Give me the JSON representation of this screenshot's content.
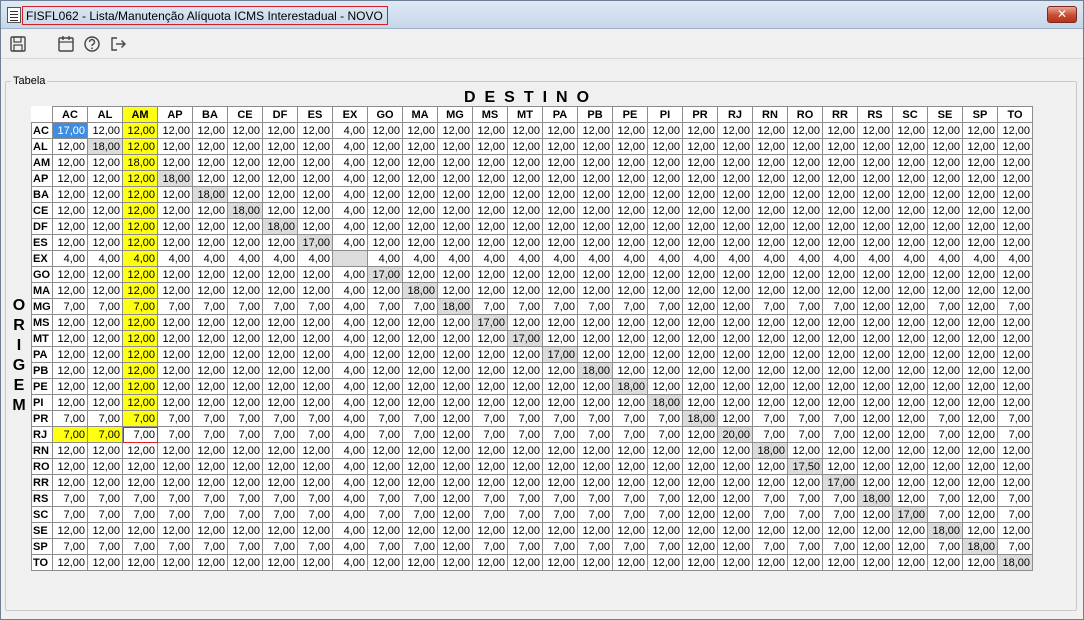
{
  "window": {
    "title": "FISFL062 - Lista/Manutenção Alíquota ICMS Interestadual - NOVO",
    "close_label": "✕"
  },
  "toolbar": {
    "icons": [
      "save-icon",
      "calendar-icon",
      "help-icon",
      "exit-icon"
    ]
  },
  "group": {
    "title": "Tabela"
  },
  "axis": {
    "destino": "DESTINO",
    "origem": [
      "O",
      "R",
      "I",
      "G",
      "E",
      "M"
    ]
  },
  "states": [
    "AC",
    "AL",
    "AM",
    "AP",
    "BA",
    "CE",
    "DF",
    "ES",
    "EX",
    "GO",
    "MA",
    "MG",
    "MS",
    "MT",
    "PA",
    "PB",
    "PE",
    "PI",
    "PR",
    "RJ",
    "RN",
    "RO",
    "RR",
    "RS",
    "SC",
    "SE",
    "SP",
    "TO"
  ],
  "rows": [
    {
      "uf": "AC",
      "v": [
        "17,00",
        "12,00",
        "12,00",
        "12,00",
        "12,00",
        "12,00",
        "12,00",
        "12,00",
        "4,00",
        "12,00",
        "12,00",
        "12,00",
        "12,00",
        "12,00",
        "12,00",
        "12,00",
        "12,00",
        "12,00",
        "12,00",
        "12,00",
        "12,00",
        "12,00",
        "12,00",
        "12,00",
        "12,00",
        "12,00",
        "12,00",
        "12,00"
      ]
    },
    {
      "uf": "AL",
      "v": [
        "12,00",
        "18,00",
        "12,00",
        "12,00",
        "12,00",
        "12,00",
        "12,00",
        "12,00",
        "4,00",
        "12,00",
        "12,00",
        "12,00",
        "12,00",
        "12,00",
        "12,00",
        "12,00",
        "12,00",
        "12,00",
        "12,00",
        "12,00",
        "12,00",
        "12,00",
        "12,00",
        "12,00",
        "12,00",
        "12,00",
        "12,00",
        "12,00"
      ]
    },
    {
      "uf": "AM",
      "v": [
        "12,00",
        "12,00",
        "18,00",
        "12,00",
        "12,00",
        "12,00",
        "12,00",
        "12,00",
        "4,00",
        "12,00",
        "12,00",
        "12,00",
        "12,00",
        "12,00",
        "12,00",
        "12,00",
        "12,00",
        "12,00",
        "12,00",
        "12,00",
        "12,00",
        "12,00",
        "12,00",
        "12,00",
        "12,00",
        "12,00",
        "12,00",
        "12,00"
      ]
    },
    {
      "uf": "AP",
      "v": [
        "12,00",
        "12,00",
        "12,00",
        "18,00",
        "12,00",
        "12,00",
        "12,00",
        "12,00",
        "4,00",
        "12,00",
        "12,00",
        "12,00",
        "12,00",
        "12,00",
        "12,00",
        "12,00",
        "12,00",
        "12,00",
        "12,00",
        "12,00",
        "12,00",
        "12,00",
        "12,00",
        "12,00",
        "12,00",
        "12,00",
        "12,00",
        "12,00"
      ]
    },
    {
      "uf": "BA",
      "v": [
        "12,00",
        "12,00",
        "12,00",
        "12,00",
        "18,00",
        "12,00",
        "12,00",
        "12,00",
        "4,00",
        "12,00",
        "12,00",
        "12,00",
        "12,00",
        "12,00",
        "12,00",
        "12,00",
        "12,00",
        "12,00",
        "12,00",
        "12,00",
        "12,00",
        "12,00",
        "12,00",
        "12,00",
        "12,00",
        "12,00",
        "12,00",
        "12,00"
      ]
    },
    {
      "uf": "CE",
      "v": [
        "12,00",
        "12,00",
        "12,00",
        "12,00",
        "12,00",
        "18,00",
        "12,00",
        "12,00",
        "4,00",
        "12,00",
        "12,00",
        "12,00",
        "12,00",
        "12,00",
        "12,00",
        "12,00",
        "12,00",
        "12,00",
        "12,00",
        "12,00",
        "12,00",
        "12,00",
        "12,00",
        "12,00",
        "12,00",
        "12,00",
        "12,00",
        "12,00"
      ]
    },
    {
      "uf": "DF",
      "v": [
        "12,00",
        "12,00",
        "12,00",
        "12,00",
        "12,00",
        "12,00",
        "18,00",
        "12,00",
        "4,00",
        "12,00",
        "12,00",
        "12,00",
        "12,00",
        "12,00",
        "12,00",
        "12,00",
        "12,00",
        "12,00",
        "12,00",
        "12,00",
        "12,00",
        "12,00",
        "12,00",
        "12,00",
        "12,00",
        "12,00",
        "12,00",
        "12,00"
      ]
    },
    {
      "uf": "ES",
      "v": [
        "12,00",
        "12,00",
        "12,00",
        "12,00",
        "12,00",
        "12,00",
        "12,00",
        "17,00",
        "4,00",
        "12,00",
        "12,00",
        "12,00",
        "12,00",
        "12,00",
        "12,00",
        "12,00",
        "12,00",
        "12,00",
        "12,00",
        "12,00",
        "12,00",
        "12,00",
        "12,00",
        "12,00",
        "12,00",
        "12,00",
        "12,00",
        "12,00"
      ]
    },
    {
      "uf": "EX",
      "v": [
        "4,00",
        "4,00",
        "4,00",
        "4,00",
        "4,00",
        "4,00",
        "4,00",
        "4,00",
        "",
        "4,00",
        "4,00",
        "4,00",
        "4,00",
        "4,00",
        "4,00",
        "4,00",
        "4,00",
        "4,00",
        "4,00",
        "4,00",
        "4,00",
        "4,00",
        "4,00",
        "4,00",
        "4,00",
        "4,00",
        "4,00",
        "4,00"
      ]
    },
    {
      "uf": "GO",
      "v": [
        "12,00",
        "12,00",
        "12,00",
        "12,00",
        "12,00",
        "12,00",
        "12,00",
        "12,00",
        "4,00",
        "17,00",
        "12,00",
        "12,00",
        "12,00",
        "12,00",
        "12,00",
        "12,00",
        "12,00",
        "12,00",
        "12,00",
        "12,00",
        "12,00",
        "12,00",
        "12,00",
        "12,00",
        "12,00",
        "12,00",
        "12,00",
        "12,00"
      ]
    },
    {
      "uf": "MA",
      "v": [
        "12,00",
        "12,00",
        "12,00",
        "12,00",
        "12,00",
        "12,00",
        "12,00",
        "12,00",
        "4,00",
        "12,00",
        "18,00",
        "12,00",
        "12,00",
        "12,00",
        "12,00",
        "12,00",
        "12,00",
        "12,00",
        "12,00",
        "12,00",
        "12,00",
        "12,00",
        "12,00",
        "12,00",
        "12,00",
        "12,00",
        "12,00",
        "12,00"
      ]
    },
    {
      "uf": "MG",
      "v": [
        "7,00",
        "7,00",
        "7,00",
        "7,00",
        "7,00",
        "7,00",
        "7,00",
        "7,00",
        "4,00",
        "7,00",
        "7,00",
        "18,00",
        "7,00",
        "7,00",
        "7,00",
        "7,00",
        "7,00",
        "7,00",
        "12,00",
        "12,00",
        "7,00",
        "7,00",
        "7,00",
        "12,00",
        "12,00",
        "7,00",
        "12,00",
        "7,00"
      ]
    },
    {
      "uf": "MS",
      "v": [
        "12,00",
        "12,00",
        "12,00",
        "12,00",
        "12,00",
        "12,00",
        "12,00",
        "12,00",
        "4,00",
        "12,00",
        "12,00",
        "12,00",
        "17,00",
        "12,00",
        "12,00",
        "12,00",
        "12,00",
        "12,00",
        "12,00",
        "12,00",
        "12,00",
        "12,00",
        "12,00",
        "12,00",
        "12,00",
        "12,00",
        "12,00",
        "12,00"
      ]
    },
    {
      "uf": "MT",
      "v": [
        "12,00",
        "12,00",
        "12,00",
        "12,00",
        "12,00",
        "12,00",
        "12,00",
        "12,00",
        "4,00",
        "12,00",
        "12,00",
        "12,00",
        "12,00",
        "17,00",
        "12,00",
        "12,00",
        "12,00",
        "12,00",
        "12,00",
        "12,00",
        "12,00",
        "12,00",
        "12,00",
        "12,00",
        "12,00",
        "12,00",
        "12,00",
        "12,00"
      ]
    },
    {
      "uf": "PA",
      "v": [
        "12,00",
        "12,00",
        "12,00",
        "12,00",
        "12,00",
        "12,00",
        "12,00",
        "12,00",
        "4,00",
        "12,00",
        "12,00",
        "12,00",
        "12,00",
        "12,00",
        "17,00",
        "12,00",
        "12,00",
        "12,00",
        "12,00",
        "12,00",
        "12,00",
        "12,00",
        "12,00",
        "12,00",
        "12,00",
        "12,00",
        "12,00",
        "12,00"
      ]
    },
    {
      "uf": "PB",
      "v": [
        "12,00",
        "12,00",
        "12,00",
        "12,00",
        "12,00",
        "12,00",
        "12,00",
        "12,00",
        "4,00",
        "12,00",
        "12,00",
        "12,00",
        "12,00",
        "12,00",
        "12,00",
        "18,00",
        "12,00",
        "12,00",
        "12,00",
        "12,00",
        "12,00",
        "12,00",
        "12,00",
        "12,00",
        "12,00",
        "12,00",
        "12,00",
        "12,00"
      ]
    },
    {
      "uf": "PE",
      "v": [
        "12,00",
        "12,00",
        "12,00",
        "12,00",
        "12,00",
        "12,00",
        "12,00",
        "12,00",
        "4,00",
        "12,00",
        "12,00",
        "12,00",
        "12,00",
        "12,00",
        "12,00",
        "12,00",
        "18,00",
        "12,00",
        "12,00",
        "12,00",
        "12,00",
        "12,00",
        "12,00",
        "12,00",
        "12,00",
        "12,00",
        "12,00",
        "12,00"
      ]
    },
    {
      "uf": "PI",
      "v": [
        "12,00",
        "12,00",
        "12,00",
        "12,00",
        "12,00",
        "12,00",
        "12,00",
        "12,00",
        "4,00",
        "12,00",
        "12,00",
        "12,00",
        "12,00",
        "12,00",
        "12,00",
        "12,00",
        "12,00",
        "18,00",
        "12,00",
        "12,00",
        "12,00",
        "12,00",
        "12,00",
        "12,00",
        "12,00",
        "12,00",
        "12,00",
        "12,00"
      ]
    },
    {
      "uf": "PR",
      "v": [
        "7,00",
        "7,00",
        "7,00",
        "7,00",
        "7,00",
        "7,00",
        "7,00",
        "7,00",
        "4,00",
        "7,00",
        "7,00",
        "12,00",
        "7,00",
        "7,00",
        "7,00",
        "7,00",
        "7,00",
        "7,00",
        "18,00",
        "12,00",
        "7,00",
        "7,00",
        "7,00",
        "12,00",
        "12,00",
        "7,00",
        "12,00",
        "7,00"
      ]
    },
    {
      "uf": "RJ",
      "v": [
        "7,00",
        "7,00",
        "7,00",
        "7,00",
        "7,00",
        "7,00",
        "7,00",
        "7,00",
        "4,00",
        "7,00",
        "7,00",
        "12,00",
        "7,00",
        "7,00",
        "7,00",
        "7,00",
        "7,00",
        "7,00",
        "12,00",
        "20,00",
        "7,00",
        "7,00",
        "7,00",
        "12,00",
        "12,00",
        "7,00",
        "12,00",
        "7,00"
      ]
    },
    {
      "uf": "RN",
      "v": [
        "12,00",
        "12,00",
        "12,00",
        "12,00",
        "12,00",
        "12,00",
        "12,00",
        "12,00",
        "4,00",
        "12,00",
        "12,00",
        "12,00",
        "12,00",
        "12,00",
        "12,00",
        "12,00",
        "12,00",
        "12,00",
        "12,00",
        "12,00",
        "18,00",
        "12,00",
        "12,00",
        "12,00",
        "12,00",
        "12,00",
        "12,00",
        "12,00"
      ]
    },
    {
      "uf": "RO",
      "v": [
        "12,00",
        "12,00",
        "12,00",
        "12,00",
        "12,00",
        "12,00",
        "12,00",
        "12,00",
        "4,00",
        "12,00",
        "12,00",
        "12,00",
        "12,00",
        "12,00",
        "12,00",
        "12,00",
        "12,00",
        "12,00",
        "12,00",
        "12,00",
        "12,00",
        "17,50",
        "12,00",
        "12,00",
        "12,00",
        "12,00",
        "12,00",
        "12,00"
      ]
    },
    {
      "uf": "RR",
      "v": [
        "12,00",
        "12,00",
        "12,00",
        "12,00",
        "12,00",
        "12,00",
        "12,00",
        "12,00",
        "4,00",
        "12,00",
        "12,00",
        "12,00",
        "12,00",
        "12,00",
        "12,00",
        "12,00",
        "12,00",
        "12,00",
        "12,00",
        "12,00",
        "12,00",
        "12,00",
        "17,00",
        "12,00",
        "12,00",
        "12,00",
        "12,00",
        "12,00"
      ]
    },
    {
      "uf": "RS",
      "v": [
        "7,00",
        "7,00",
        "7,00",
        "7,00",
        "7,00",
        "7,00",
        "7,00",
        "7,00",
        "4,00",
        "7,00",
        "7,00",
        "12,00",
        "7,00",
        "7,00",
        "7,00",
        "7,00",
        "7,00",
        "7,00",
        "12,00",
        "12,00",
        "7,00",
        "7,00",
        "7,00",
        "18,00",
        "12,00",
        "7,00",
        "12,00",
        "7,00"
      ]
    },
    {
      "uf": "SC",
      "v": [
        "7,00",
        "7,00",
        "7,00",
        "7,00",
        "7,00",
        "7,00",
        "7,00",
        "7,00",
        "4,00",
        "7,00",
        "7,00",
        "12,00",
        "7,00",
        "7,00",
        "7,00",
        "7,00",
        "7,00",
        "7,00",
        "12,00",
        "12,00",
        "7,00",
        "7,00",
        "7,00",
        "12,00",
        "17,00",
        "7,00",
        "12,00",
        "7,00"
      ]
    },
    {
      "uf": "SE",
      "v": [
        "12,00",
        "12,00",
        "12,00",
        "12,00",
        "12,00",
        "12,00",
        "12,00",
        "12,00",
        "4,00",
        "12,00",
        "12,00",
        "12,00",
        "12,00",
        "12,00",
        "12,00",
        "12,00",
        "12,00",
        "12,00",
        "12,00",
        "12,00",
        "12,00",
        "12,00",
        "12,00",
        "12,00",
        "12,00",
        "18,00",
        "12,00",
        "12,00"
      ]
    },
    {
      "uf": "SP",
      "v": [
        "7,00",
        "7,00",
        "7,00",
        "7,00",
        "7,00",
        "7,00",
        "7,00",
        "7,00",
        "4,00",
        "7,00",
        "7,00",
        "12,00",
        "7,00",
        "7,00",
        "7,00",
        "7,00",
        "7,00",
        "7,00",
        "12,00",
        "12,00",
        "7,00",
        "7,00",
        "7,00",
        "12,00",
        "12,00",
        "7,00",
        "18,00",
        "7,00"
      ]
    },
    {
      "uf": "TO",
      "v": [
        "12,00",
        "12,00",
        "12,00",
        "12,00",
        "12,00",
        "12,00",
        "12,00",
        "12,00",
        "4,00",
        "12,00",
        "12,00",
        "12,00",
        "12,00",
        "12,00",
        "12,00",
        "12,00",
        "12,00",
        "12,00",
        "12,00",
        "12,00",
        "12,00",
        "12,00",
        "12,00",
        "12,00",
        "12,00",
        "12,00",
        "12,00",
        "18,00"
      ]
    }
  ],
  "highlight": {
    "column": "AM",
    "row": "RJ",
    "selected_cell": {
      "row": "AC",
      "col": "AC"
    },
    "focused_cell": {
      "row": "RJ",
      "col": "AM"
    },
    "colors": {
      "highlight": "#ffff10",
      "diagonal": "#dcdcdc",
      "selection": "#3f8de0",
      "focus": "#e02020"
    }
  }
}
